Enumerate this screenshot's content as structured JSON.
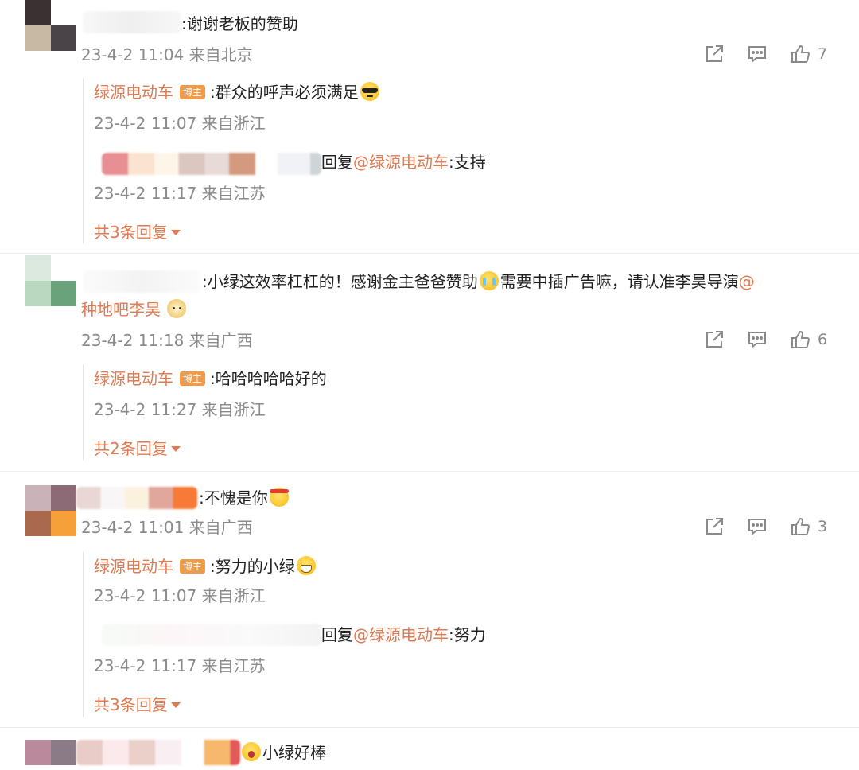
{
  "colors": {
    "link": "#e2794f",
    "badge": "#f19a48",
    "meta": "#8a8a8a",
    "text": "#1f1f1f"
  },
  "icons": [
    "share-icon",
    "comment-icon",
    "like-icon",
    "expand-caret-icon"
  ],
  "comments": [
    {
      "text": ":谢谢老板的赞助",
      "meta": "23-4-2 11:04 来自北京",
      "likes": "7",
      "replies": [
        {
          "author": "绿源电动车",
          "badge": "博主",
          "text": ":群众的呼声必须满足",
          "meta": "23-4-2 11:07 来自浙江"
        },
        {
          "reply_prefix": "回复",
          "mention": "@绿源电动车",
          "text": ":支持",
          "meta": "23-4-2 11:17 来自江苏"
        }
      ],
      "more_replies": "共3条回复"
    },
    {
      "text_a": ":小绿这效率杠杠的！感谢金主爸爸赞助",
      "text_b": "需要中插广告嘛，请认准李昊导演",
      "mention_a": "@",
      "mention_b": "种地吧李昊",
      "meta": "23-4-2 11:18 来自广西",
      "likes": "6",
      "replies": [
        {
          "author": "绿源电动车",
          "badge": "博主",
          "text": ":哈哈哈哈哈好的",
          "meta": "23-4-2 11:27 来自浙江"
        }
      ],
      "more_replies": "共2条回复"
    },
    {
      "text": ":不愧是你",
      "meta": "23-4-2 11:01 来自广西",
      "likes": "3",
      "replies": [
        {
          "author": "绿源电动车",
          "badge": "博主",
          "text": ":努力的小绿",
          "meta": "23-4-2 11:07 来自浙江"
        },
        {
          "reply_prefix": "回复",
          "mention": "@绿源电动车",
          "text": ":努力",
          "meta": "23-4-2 11:17 来自江苏"
        }
      ],
      "more_replies": "共3条回复"
    },
    {
      "text": "小绿好棒"
    }
  ]
}
